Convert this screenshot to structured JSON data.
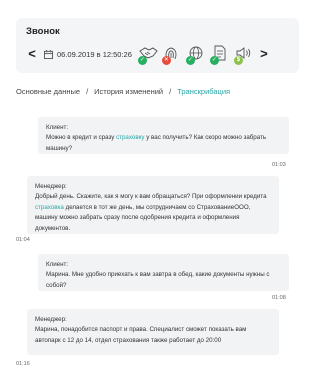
{
  "call": {
    "title": "Звонок",
    "datetime": "06.09.2019 в 12:50:26",
    "prev_label": "<",
    "next_label": ">",
    "status_icons": [
      {
        "name": "handshake-icon",
        "badge": "ok",
        "badge_color": "#27ae60"
      },
      {
        "name": "fingerprint-icon",
        "badge": "error",
        "badge_color": "#e74c3c"
      },
      {
        "name": "globe-icon",
        "badge": "ok",
        "badge_color": "#27ae60"
      },
      {
        "name": "document-icon",
        "badge": "ok",
        "badge_color": "#27ae60"
      },
      {
        "name": "speaker-icon",
        "badge": "dollar",
        "badge_color": "#8bc34a"
      }
    ]
  },
  "breadcrumb": {
    "item1": "Основные данные",
    "separator": "/",
    "item2": "История изменений",
    "item3": "Транскрибация"
  },
  "colors": {
    "accent": "#2aa7a7",
    "bubble_bg": "#f2f3f5",
    "card_bg": "#f4f5f7"
  },
  "messages": [
    {
      "speaker": "Клиент:",
      "text_before": "Можно в кредит и сразу ",
      "highlight": "страховку",
      "text_after": " у вас получить? Как скоро можно забрать машину?",
      "time": "01:03"
    },
    {
      "speaker": "Менеджер:",
      "text_before": "Добрый день. Скажите, как я могу к вам обращаться? При оформлении кредита ",
      "highlight": "страховка",
      "text_after": " делается в тот же день, мы сотрудничаем со СтрахованиеООО, машину можно забрать сразу после одобрения кредита и оформления документов.",
      "time": "01:04"
    },
    {
      "speaker": "Клиент:",
      "text_before": "Марина. Мне удобно приехать к вам завтра в обед, какие документы нужны с собой?",
      "highlight": "",
      "text_after": "",
      "time": "01:08"
    },
    {
      "speaker": "Менеджер:",
      "text_before": "Марина, понадобится паспорт и права. Специалист сможет показать вам автопарк с 12 до 14, отдел страхования также работает до 20:00",
      "highlight": "",
      "text_after": "",
      "time": "01:16"
    }
  ]
}
